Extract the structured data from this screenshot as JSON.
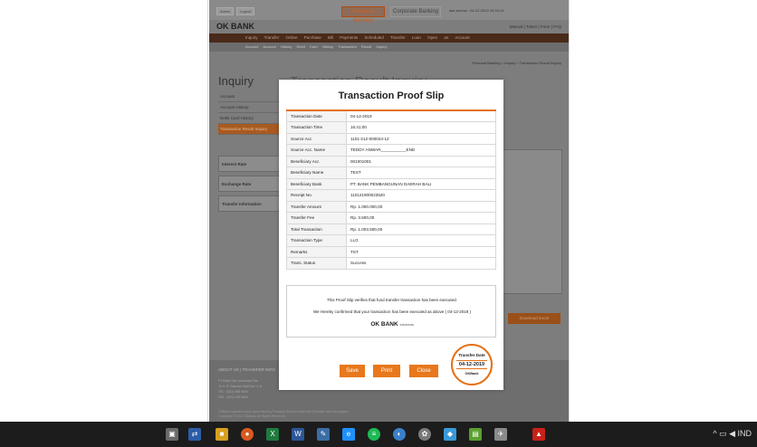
{
  "site": {
    "topbar": {
      "admin_label": "Admin",
      "logout_label": "Logout",
      "tab_personal": "Personal Banking",
      "tab_corporate": "Corporate Banking",
      "last_access": "last access : 04-12-2019 16:16:13"
    },
    "logo": "OK BANK",
    "toplinks": "Manual | Token | Form | FAQ",
    "nav": "Inquiry Transfer Online Purchase Bill Payments Scheduled Transfer Loan Open an Account",
    "subnav": "Account Account History Debit Card History Transaction Result Inquiry",
    "breadcrumb": "Personal Banking > Inquiry > Transaction Result Inquiry",
    "inquiry_heading": "Inquiry",
    "page_title": "Transaction Result Inquiry",
    "side_menu": [
      "Account",
      "Account History",
      "Debit Card History",
      "Transaction Result Inquiry"
    ],
    "side_boxes": [
      "Interest Rate",
      "Exchange Rate",
      "Transfer Information"
    ],
    "download_label": "Download Excel",
    "footer_heading": "ABOUT US | TRANSFER INFO",
    "footer_lines": [
      "PT Bank Oke Indonesia Tbk.",
      "Jl. H. R. Rasuna Said Kav. C-6",
      "TEL : (021) 255 4000",
      "FAX : (021) 255 4001"
    ],
    "footer_bottom": [
      "OKBank registered and supervised by Financial Services Authority (Otoritas Jasa Keuangan)",
      "Copyright © 2017 OKBank. All Rights Reserved."
    ]
  },
  "modal": {
    "title": "Transaction Proof Slip",
    "rows": [
      {
        "label": "Transaction Date",
        "value": "04-12-2019"
      },
      {
        "label": "Transaction Time",
        "value": "16:41:00"
      },
      {
        "label": "Source Acc",
        "value": "1101-212-000024-12"
      },
      {
        "label": "Source Acc. Name",
        "value": "TEDDY ANWAR___________END"
      },
      {
        "label": "Beneficiary Acc",
        "value": "001001001"
      },
      {
        "label": "Beneficiary Name",
        "value": "TEST"
      },
      {
        "label": "Beneficiary Bank",
        "value": "PT. BANK PEMBANGUNAN DAERAH BALI"
      },
      {
        "label": "Receipt No.",
        "value": "110121900023520"
      },
      {
        "label": "Transfer Amount",
        "value": "Rp. 1.000.000,00"
      },
      {
        "label": "Transfer Fee",
        "value": "Rp. 3.500,00"
      },
      {
        "label": "Total Transaction",
        "value": "Rp. 1.003.500,00"
      },
      {
        "label": "Transaction Type",
        "value": "LLG"
      },
      {
        "label": "Remarks",
        "value": "TST"
      },
      {
        "label": "Trans. Status",
        "value": "Success"
      }
    ],
    "note_line1": "This Proof Slip verifies that fund transfer transaction has been executed.",
    "note_line2": "We Hereby confirmed that your transaction has been executed as above ( 04-12-2019 )",
    "note_logo": "OK BANK",
    "note_logo_sub": "Indonesia",
    "buttons": {
      "save": "Save",
      "print": "Print",
      "close": "Close"
    },
    "stamp": {
      "label": "Transfer Date",
      "date": "04-12-2019",
      "bank": "OKBank"
    }
  },
  "taskbar": {
    "tray_text": "^ ▭ ◀ IND"
  },
  "colors": {
    "accent": "#e8781c",
    "brand_dark": "#4a2a1a"
  }
}
